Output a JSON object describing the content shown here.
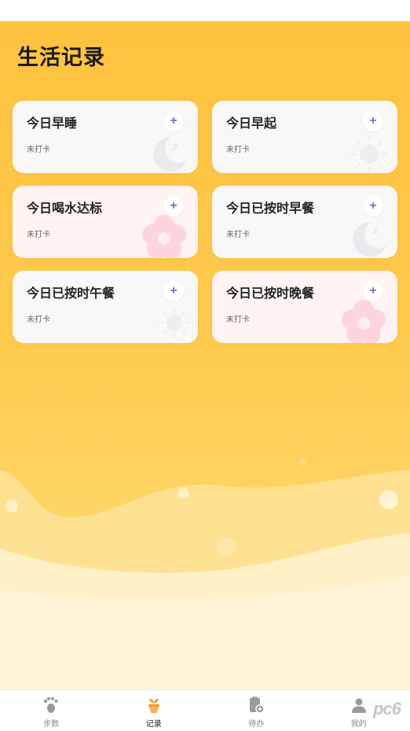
{
  "page": {
    "title": "生活记录"
  },
  "cards": [
    {
      "title": "今日早睡",
      "status": "未打卡",
      "add": "+",
      "icon": "moon-icon"
    },
    {
      "title": "今日早起",
      "status": "未打卡",
      "add": "+",
      "icon": "sun-icon"
    },
    {
      "title": "今日喝水达标",
      "status": "未打卡",
      "add": "+",
      "icon": "flower-icon"
    },
    {
      "title": "今日已按时早餐",
      "status": "未打卡",
      "add": "+",
      "icon": "moon-icon"
    },
    {
      "title": "今日已按时午餐",
      "status": "未打卡",
      "add": "+",
      "icon": "sun-icon"
    },
    {
      "title": "今日已按时晚餐",
      "status": "未打卡",
      "add": "+",
      "icon": "flower-icon"
    }
  ],
  "tabbar": {
    "items": [
      {
        "label": "步数",
        "icon": "footprint-icon"
      },
      {
        "label": "记录",
        "icon": "plant-pot-icon",
        "active": true
      },
      {
        "label": "待办",
        "icon": "clipboard-add-icon"
      },
      {
        "label": "我的",
        "icon": "profile-icon"
      }
    ]
  },
  "watermark": {
    "text": "pc6"
  },
  "colors": {
    "accent": "#7e6bd6",
    "background": "#ffc23f",
    "active_tab": "#f39c2b"
  }
}
